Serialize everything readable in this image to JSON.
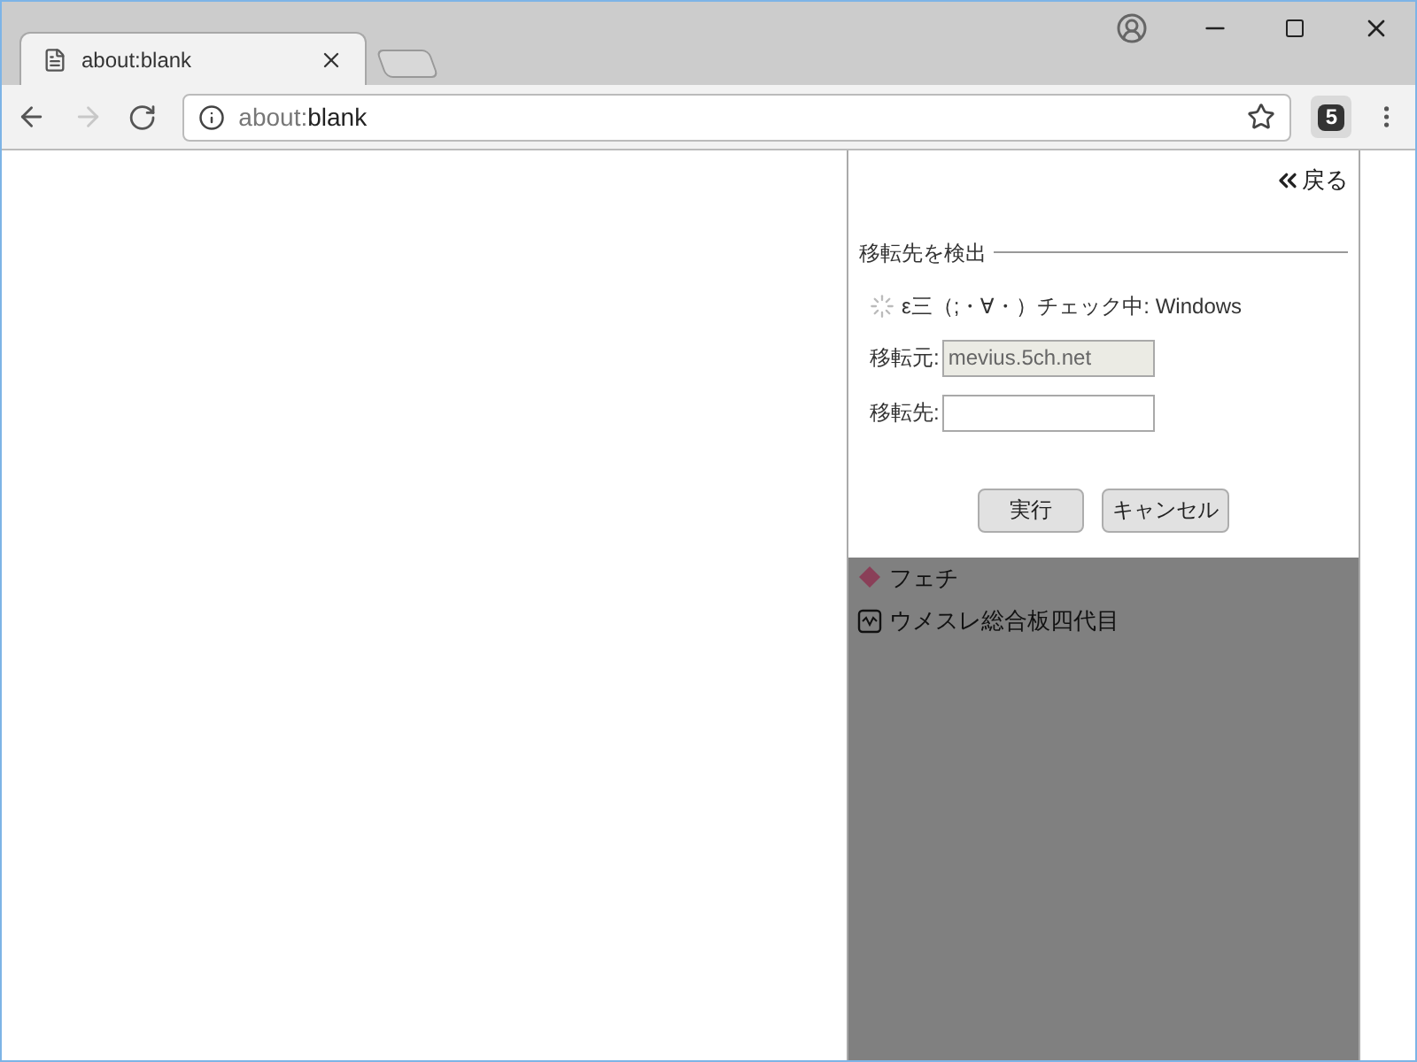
{
  "tab": {
    "title": "about:blank"
  },
  "address_bar": {
    "prefix": "about:",
    "host": "blank"
  },
  "extension_badge": "5",
  "panel": {
    "back": "戻る",
    "section_title": "移転先を検出",
    "status": "ε三（;・∀・）チェック中: Windows",
    "fields": [
      {
        "label": "移転元:",
        "value": "mevius.5ch.net",
        "disabled": true
      },
      {
        "label": "移転先:",
        "disabled": false
      }
    ],
    "buttons": [
      "実行",
      "キャンセル"
    ]
  },
  "list_items": [
    {
      "kind": "tag",
      "label": "フェチ"
    },
    {
      "kind": "board",
      "label": "ウメスレ総合板四代目"
    }
  ]
}
